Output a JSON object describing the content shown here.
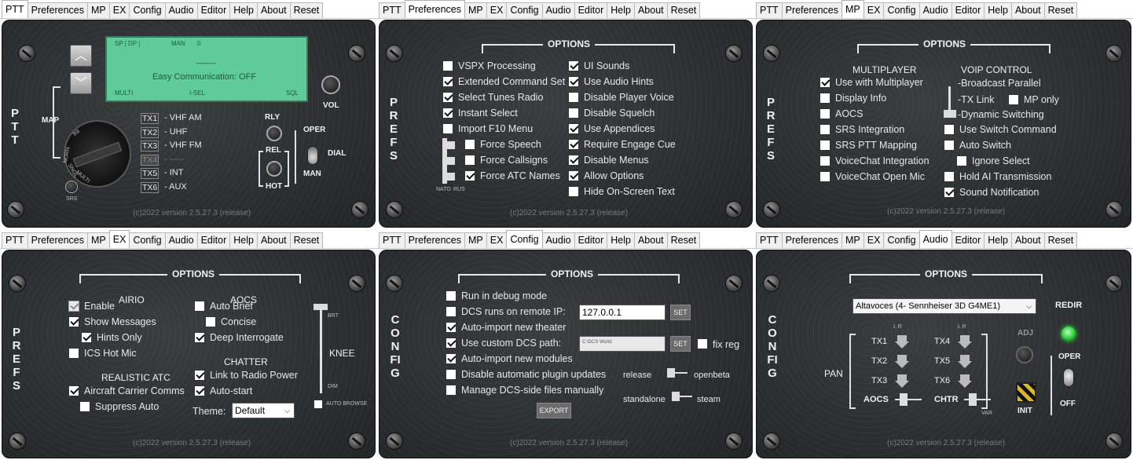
{
  "tabs": [
    "PTT",
    "Preferences",
    "MP",
    "EX",
    "Config",
    "Audio",
    "Editor",
    "Help",
    "About",
    "Reset"
  ],
  "version": "(c)2022 version 2.5.27.3 (release)",
  "options_title": "OPTIONS",
  "ptt": {
    "side_label": "PTT",
    "lcd": {
      "top_left": "SP | DP |",
      "man": "MAN",
      "man_value": "0",
      "dashes": "____",
      "status": "Easy Communication: OFF",
      "bottom_left": "MULTI",
      "bottom_mid": "I-SEL",
      "bottom_right": "SQL"
    },
    "vol_label": "VOL",
    "map_label": "MAP",
    "rotary_labels": [
      "INI",
      "NORN",
      "MULTI",
      "SNGL"
    ],
    "tx": [
      {
        "tag": "TX1",
        "label": "- VHF AM"
      },
      {
        "tag": "TX2",
        "label": "- UHF"
      },
      {
        "tag": "TX3",
        "label": "- VHF FM"
      },
      {
        "tag": "TX4",
        "label": "- -----"
      },
      {
        "tag": "TX5",
        "label": "- INT"
      },
      {
        "tag": "TX6",
        "label": "- AUX"
      }
    ],
    "rly": "RLY",
    "rel": "REL",
    "hot": "HOT",
    "oper": "OPER",
    "dial": "DIAL",
    "man": "MAN",
    "srs": "SRS"
  },
  "prefs": {
    "side_label": "PREFS",
    "left": [
      {
        "label": "VSPX Processing",
        "checked": false
      },
      {
        "label": "Extended Command Set",
        "checked": true
      },
      {
        "label": "Select Tunes Radio",
        "checked": true
      },
      {
        "label": "Instant Select",
        "checked": true
      },
      {
        "label": "Import F10 Menu",
        "checked": false
      },
      {
        "label": "Force Speech",
        "checked": false
      },
      {
        "label": "Force Callsigns",
        "checked": false
      },
      {
        "label": "Force ATC Names",
        "checked": true
      }
    ],
    "right": [
      {
        "label": "UI Sounds",
        "checked": true
      },
      {
        "label": "Use Audio Hints",
        "checked": true
      },
      {
        "label": "Disable Player Voice",
        "checked": false
      },
      {
        "label": "Disable Squelch",
        "checked": false
      },
      {
        "label": "Use Appendices",
        "checked": true
      },
      {
        "label": "Require Engage Cue",
        "checked": true
      },
      {
        "label": "Disable Menus",
        "checked": true
      },
      {
        "label": "Allow Options",
        "checked": true
      },
      {
        "label": "Hide On-Screen Text",
        "checked": false
      }
    ],
    "nato": "NATO",
    "rus": "RUS"
  },
  "mp": {
    "side_label": "PREFS",
    "mp_title": "MULTIPLAYER",
    "voip_title": "VOIP CONTROL",
    "left": [
      {
        "label": "Use with Multiplayer",
        "checked": true
      },
      {
        "label": "Display Info",
        "checked": false
      },
      {
        "label": "AOCS",
        "checked": false
      },
      {
        "label": "SRS Integration",
        "checked": false
      },
      {
        "label": "SRS PTT Mapping",
        "checked": false
      },
      {
        "label": "VoiceChat Integration",
        "checked": false
      },
      {
        "label": "VoiceChat Open Mic",
        "checked": false
      }
    ],
    "voip_modes": [
      "-Broadcast Parallel",
      "-TX Link",
      "-Dynamic Switching"
    ],
    "mp_only": {
      "label": "MP only",
      "checked": false
    },
    "right": [
      {
        "label": "Use Switch Command",
        "checked": false
      },
      {
        "label": "Auto Switch",
        "checked": false
      },
      {
        "label": "Ignore Select",
        "checked": false
      },
      {
        "label": "Hold AI Transmission",
        "checked": false
      },
      {
        "label": "Sound Notification",
        "checked": true
      }
    ]
  },
  "ex": {
    "side_label": "PREFS",
    "airio_title": "AIRIO",
    "airio": [
      {
        "label": "Enable",
        "checked": true,
        "disabled": true
      },
      {
        "label": "Show Messages",
        "checked": true
      },
      {
        "label": "Hints Only",
        "checked": true
      },
      {
        "label": "ICS Hot Mic",
        "checked": false
      }
    ],
    "ratc_title": "REALISTIC ATC",
    "ratc": [
      {
        "label": "Aircraft Carrier Comms",
        "checked": true
      },
      {
        "label": "Suppress Auto",
        "checked": false
      }
    ],
    "aocs_title": "AOCS",
    "aocs": [
      {
        "label": "Auto Brief",
        "checked": false
      },
      {
        "label": "Concise",
        "checked": false
      },
      {
        "label": "Deep Interrogate",
        "checked": true
      }
    ],
    "chatter_title": "CHATTER",
    "chatter": [
      {
        "label": "Link to Radio Power",
        "checked": true
      },
      {
        "label": "Auto-start",
        "checked": true
      }
    ],
    "theme_label": "Theme:",
    "theme_value": "Default",
    "knee": "KNEE",
    "brt": "BRT",
    "dim": "DIM",
    "auto_browse": {
      "label": "AUTO BROWSE",
      "checked": false
    }
  },
  "config": {
    "side_label": "CONFIG",
    "items": [
      {
        "label": "Run in debug mode",
        "checked": false
      },
      {
        "label": "DCS runs on remote IP:",
        "checked": false
      },
      {
        "label": "Auto-import new theater",
        "checked": true
      },
      {
        "label": "Use custom DCS path:",
        "checked": true
      },
      {
        "label": "Auto-import new modules",
        "checked": true
      },
      {
        "label": "Disable automatic plugin updates",
        "checked": false
      },
      {
        "label": "Manage DCS-side files manually",
        "checked": false
      }
    ],
    "ip_value": "127.0.0.1",
    "path_value": "C:\\DCS World",
    "set": "SET",
    "fix_reg": {
      "label": "fix reg",
      "checked": false
    },
    "release": "release",
    "openbeta": "openbeta",
    "standalone": "standalone",
    "steam": "steam",
    "export": "EXPORT"
  },
  "audio": {
    "side_label": "CONFIG",
    "device": "Altavoces (4- Sennheiser 3D G4ME1)",
    "redir": "REDIR",
    "pan": "PAN",
    "tx_left": [
      "TX1",
      "TX2",
      "TX3"
    ],
    "tx_right": [
      "TX4",
      "TX5",
      "TX6"
    ],
    "aocs": "AOCS",
    "chtr": "CHTR",
    "var": "VAR",
    "adj": "ADJ",
    "init": "INIT",
    "oper": "OPER",
    "off": "OFF",
    "lr": "L   R"
  }
}
